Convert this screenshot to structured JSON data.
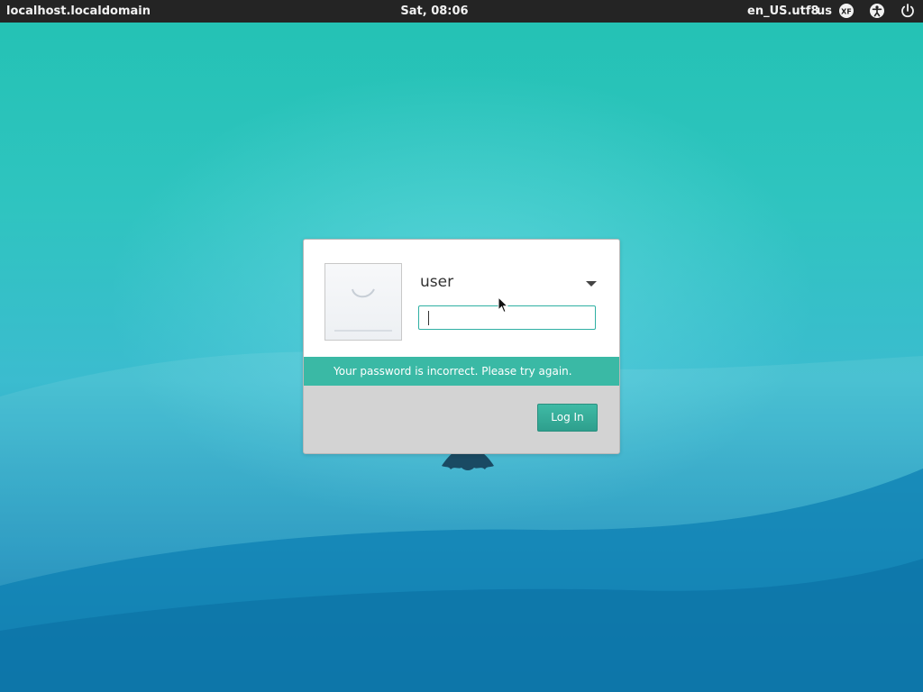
{
  "topbar": {
    "hostname": "localhost.localdomain",
    "clock": "Sat, 08:06",
    "locale": "en_US.utf8",
    "keyboard_layout": "us",
    "icons": [
      "xf-icon",
      "accessibility-icon",
      "power-icon"
    ]
  },
  "login": {
    "username": "user",
    "password_value": "",
    "error_message": "Your password is incorrect. Please try again.",
    "login_button": "Log In"
  },
  "colors": {
    "accent": "#3ab9a5",
    "topbar_bg": "#242424",
    "input_border": "#2fb0a3"
  }
}
